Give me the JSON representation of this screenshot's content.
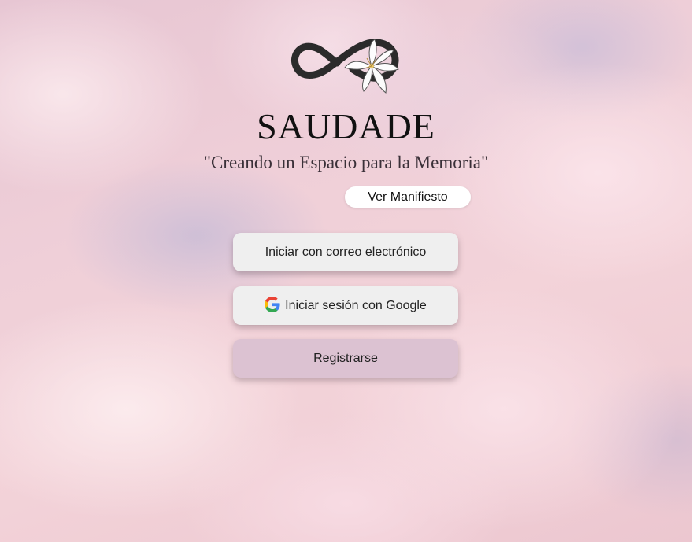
{
  "app": {
    "title": "SAUDADE",
    "tagline": "\"Creando un Espacio para la Memoria\""
  },
  "logo": {
    "icon": "infinity-lily-logo",
    "accent": "#2b2b2b"
  },
  "manifest": {
    "label": "Ver Manifiesto"
  },
  "auth": {
    "email_label": "Iniciar con correo electrónico",
    "google_label": "Iniciar sesión con Google",
    "google_icon": "google-icon",
    "register_label": "Registrarse"
  },
  "colors": {
    "register_bg": "#dcc2d2",
    "button_bg": "#efefef",
    "google_blue": "#4285F4",
    "google_red": "#EA4335",
    "google_yellow": "#FBBC05",
    "google_green": "#34A853"
  }
}
